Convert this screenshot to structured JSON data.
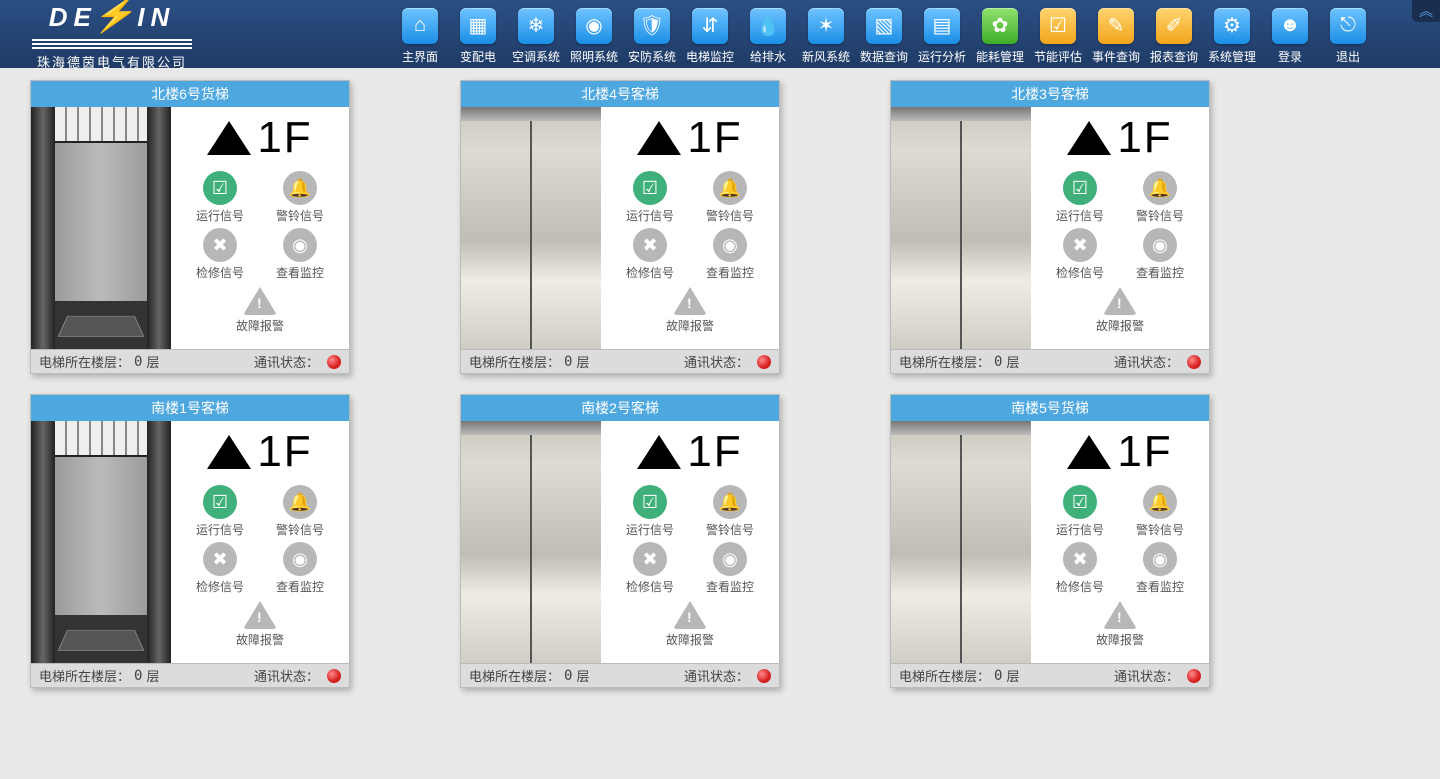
{
  "company": "珠海德茵电气有限公司",
  "logo_parts": {
    "left": "DE",
    "right": "IN"
  },
  "nav": [
    {
      "label": "主界面",
      "icon": "home",
      "color": "blue"
    },
    {
      "label": "变配电",
      "icon": "power",
      "color": "blue"
    },
    {
      "label": "空调系统",
      "icon": "ac",
      "color": "blue"
    },
    {
      "label": "照明系统",
      "icon": "light",
      "color": "blue"
    },
    {
      "label": "安防系统",
      "icon": "shield",
      "color": "blue"
    },
    {
      "label": "电梯监控",
      "icon": "elevator",
      "color": "blue"
    },
    {
      "label": "给排水",
      "icon": "water",
      "color": "blue"
    },
    {
      "label": "新风系统",
      "icon": "fan",
      "color": "blue"
    },
    {
      "label": "数据查询",
      "icon": "data",
      "color": "blue"
    },
    {
      "label": "运行分析",
      "icon": "analysis",
      "color": "blue"
    },
    {
      "label": "能耗管理",
      "icon": "energy",
      "color": "green"
    },
    {
      "label": "节能评估",
      "icon": "eval",
      "color": "orange"
    },
    {
      "label": "事件查询",
      "icon": "event",
      "color": "orange"
    },
    {
      "label": "报表查询",
      "icon": "report",
      "color": "orange"
    },
    {
      "label": "系统管理",
      "icon": "settings",
      "color": "blue"
    },
    {
      "label": "登录",
      "icon": "login",
      "color": "blue"
    },
    {
      "label": "退出",
      "icon": "exit",
      "color": "blue"
    }
  ],
  "signals": {
    "run": "运行信号",
    "alarm": "警铃信号",
    "repair": "检修信号",
    "camera": "查看监控",
    "fault": "故障报警"
  },
  "footer_labels": {
    "floor": "电梯所在楼层：",
    "unit": "层",
    "comm": "通讯状态："
  },
  "comm_color": "#d61f1f",
  "elevators": [
    {
      "title": "北楼6号货梯",
      "door": "open",
      "dir": "up",
      "floor_display": "1F",
      "current_floor": "0",
      "comm": "bad"
    },
    {
      "title": "北楼4号客梯",
      "door": "closed",
      "dir": "up",
      "floor_display": "1F",
      "current_floor": "0",
      "comm": "bad"
    },
    {
      "title": "北楼3号客梯",
      "door": "closed",
      "dir": "up",
      "floor_display": "1F",
      "current_floor": "0",
      "comm": "bad"
    },
    {
      "title": "南楼1号客梯",
      "door": "open",
      "dir": "up",
      "floor_display": "1F",
      "current_floor": "0",
      "comm": "bad"
    },
    {
      "title": "南楼2号客梯",
      "door": "closed",
      "dir": "up",
      "floor_display": "1F",
      "current_floor": "0",
      "comm": "bad"
    },
    {
      "title": "南楼5号货梯",
      "door": "closed",
      "dir": "up",
      "floor_display": "1F",
      "current_floor": "0",
      "comm": "bad"
    }
  ]
}
